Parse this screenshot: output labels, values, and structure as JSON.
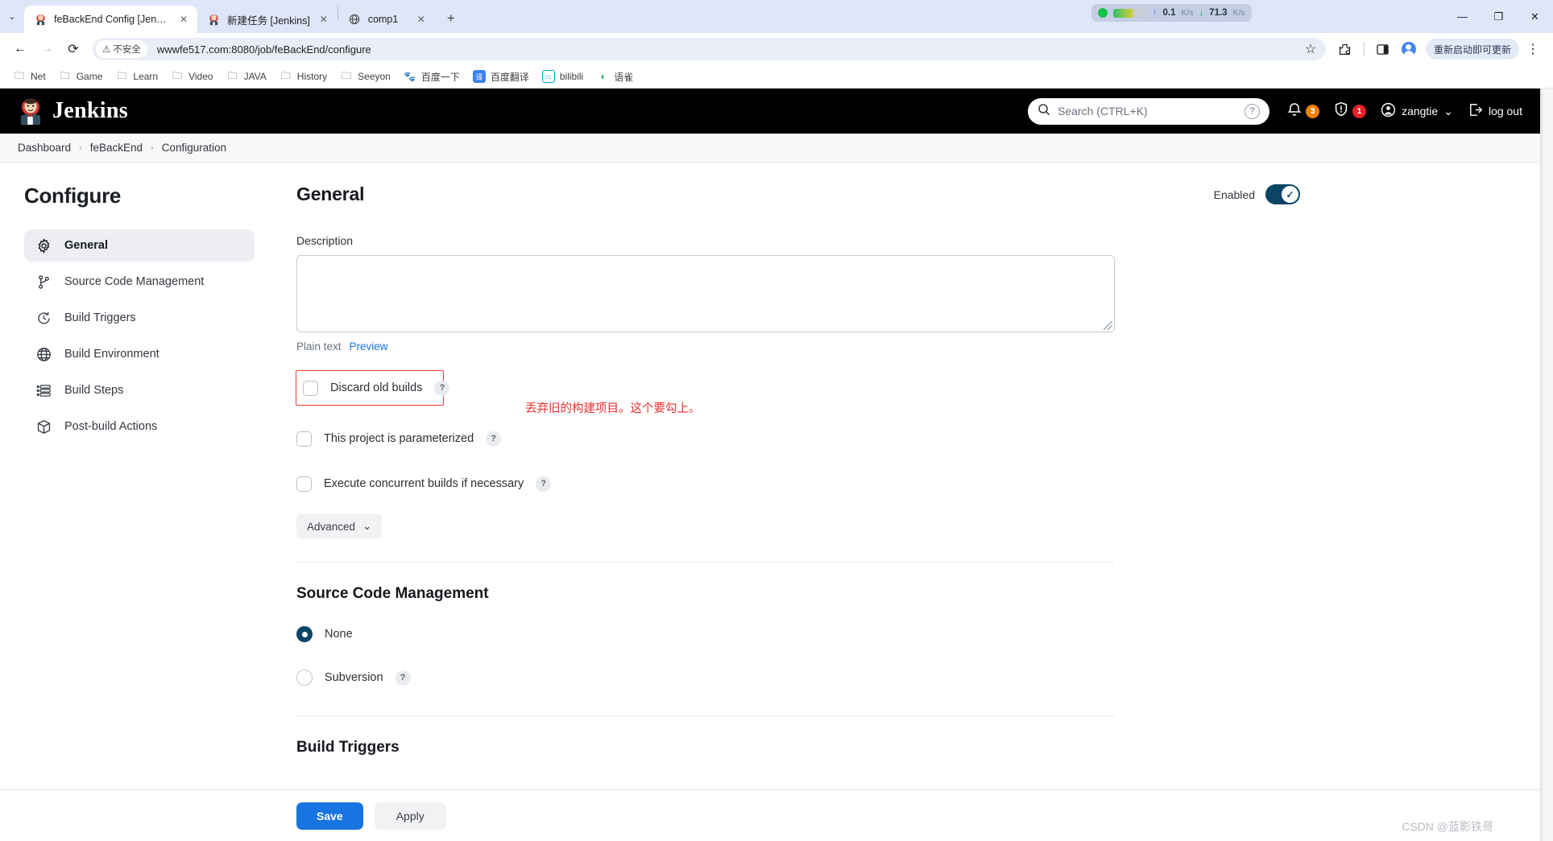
{
  "browser": {
    "tabs": [
      {
        "title": "feBackEnd Config [Jenkins]",
        "favicon": "jenkins-favicon",
        "active": true
      },
      {
        "title": "新建任务 [Jenkins]",
        "favicon": "jenkins-favicon",
        "active": false
      },
      {
        "title": "comp1",
        "favicon": "globe-favicon",
        "active": false
      }
    ],
    "new_tab_label": "+",
    "tab_list_chevron": "⌄",
    "close_glyph": "✕",
    "window_controls": {
      "minimize": "—",
      "maximize": "❐",
      "close": "✕"
    },
    "net_widget": {
      "upload_value": "0.1",
      "upload_unit": "K/s",
      "download_value": "71.3",
      "download_unit": "K/s",
      "up_arrow": "↑",
      "down_arrow": "↓"
    },
    "toolbar": {
      "back": "←",
      "forward": "→",
      "reload": "⟳",
      "security_label": "不安全",
      "security_glyph": "⚠",
      "url": "wwwfe517.com:8080/job/feBackEnd/configure",
      "bookmark_star": "☆",
      "extensions": "⛊",
      "side_panel": "▯",
      "profile": "profile-avatar",
      "update_label": "重新启动即可更新",
      "menu": "⋮"
    },
    "bookmarks": [
      {
        "label": "Net",
        "icon": "folder-icon"
      },
      {
        "label": "Game",
        "icon": "folder-icon"
      },
      {
        "label": "Learn",
        "icon": "folder-icon"
      },
      {
        "label": "Video",
        "icon": "folder-icon"
      },
      {
        "label": "JAVA",
        "icon": "folder-icon"
      },
      {
        "label": "History",
        "icon": "folder-icon"
      },
      {
        "label": "Seeyon",
        "icon": "folder-icon"
      },
      {
        "label": "百度一下",
        "icon": "baidu-icon"
      },
      {
        "label": "百度翻译",
        "icon": "fanyi-icon"
      },
      {
        "label": "bilibili",
        "icon": "bilibili-icon"
      },
      {
        "label": "语雀",
        "icon": "yuque-icon"
      }
    ]
  },
  "jenkins": {
    "brand": "Jenkins",
    "search": {
      "placeholder": "Search (CTRL+K)",
      "search_icon": "search-icon",
      "help_glyph": "?"
    },
    "notifications": {
      "icon": "bell-icon",
      "count": "3"
    },
    "security": {
      "icon": "shield-icon",
      "count": "1"
    },
    "user": {
      "name": "zangtie",
      "icon": "user-circle-icon",
      "chevron": "⌄"
    },
    "logout": {
      "label": "log out",
      "icon": "logout-icon"
    },
    "breadcrumbs": [
      {
        "label": "Dashboard"
      },
      {
        "label": "feBackEnd"
      },
      {
        "label": "Configuration"
      }
    ],
    "breadcrumb_separator": "›"
  },
  "sidebar": {
    "title": "Configure",
    "items": [
      {
        "label": "General",
        "icon": "gear-icon",
        "active": true
      },
      {
        "label": "Source Code Management",
        "icon": "branch-icon",
        "active": false
      },
      {
        "label": "Build Triggers",
        "icon": "clock-icon",
        "active": false
      },
      {
        "label": "Build Environment",
        "icon": "globe-icon",
        "active": false
      },
      {
        "label": "Build Steps",
        "icon": "list-icon",
        "active": false
      },
      {
        "label": "Post-build Actions",
        "icon": "package-icon",
        "active": false
      }
    ]
  },
  "main": {
    "section_general": {
      "title": "General",
      "enabled_label": "Enabled",
      "enabled_state": "on",
      "toggle_check_glyph": "✓",
      "description_label": "Description",
      "description_value": "",
      "markup_mode": "Plain text",
      "preview_link": "Preview",
      "checkboxes": [
        {
          "label": "Discard old builds",
          "checked": false,
          "help": "?",
          "highlighted": true
        },
        {
          "label": "This project is parameterized",
          "checked": false,
          "help": "?",
          "highlighted": false
        },
        {
          "label": "Execute concurrent builds if necessary",
          "checked": false,
          "help": "?",
          "highlighted": false
        }
      ],
      "annotation": "丢弃旧的构建项目。这个要勾上。",
      "annotation_color": "#e8302f",
      "advanced_label": "Advanced",
      "advanced_chevron": "⌄"
    },
    "section_scm": {
      "title": "Source Code Management",
      "options": [
        {
          "label": "None",
          "selected": true,
          "help": ""
        },
        {
          "label": "Subversion",
          "selected": false,
          "help": "?"
        }
      ]
    },
    "section_triggers": {
      "title": "Build Triggers"
    },
    "footer": {
      "save_label": "Save",
      "apply_label": "Apply"
    }
  },
  "watermark": "CSDN @蓝影铁哥",
  "colors": {
    "accent_blue": "#1874e1",
    "jenkins_navy": "#0b4566",
    "annotation_red": "#e8302f",
    "badge_orange": "#f0820b",
    "badge_red": "#e8202a"
  }
}
